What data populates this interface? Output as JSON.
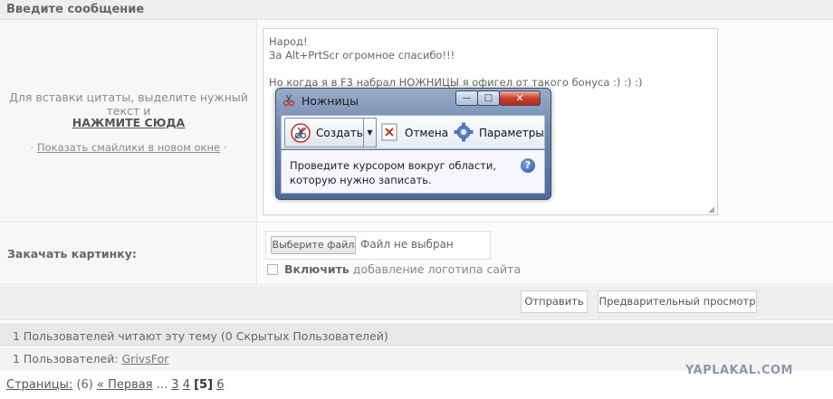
{
  "header": {
    "title": "Введите сообщение"
  },
  "message": {
    "quote_hint": "Для вставки цитаты, выделите нужный текст и",
    "quote_link": "НАЖМИТЕ СЮДА",
    "smiles_prefix": "·",
    "smiles_link": "Показать смайлики в новом окне",
    "smiles_suffix": "·",
    "text": "Народ!\nЗа Alt+PrtScr огромное спасибо!!!\n\nНо когда я в F3 набрал НОЖНИЦЫ я офигел от такого бонуса :) :) :)"
  },
  "snipping_tool": {
    "title": "Ножницы",
    "create_label": "Создать",
    "cancel_label": "Отмена",
    "options_label": "Параметры",
    "instruction": "Проведите курсором вокруг области, которую нужно записать.",
    "icons": {
      "app": "scissors-icon",
      "create": "scissors-icon",
      "cancel": "cancel-x-icon",
      "options": "gear-icon",
      "help": "help-icon"
    },
    "help_glyph": "?",
    "window_controls": {
      "minimize": "—",
      "maximize": "□",
      "close": "✕"
    }
  },
  "upload": {
    "label": "Закачать картинку:",
    "file_button": "Выберите файл",
    "file_status": "Файл не выбран",
    "logo_bold": "Включить",
    "logo_rest": "добавление логотипа сайта"
  },
  "actions": {
    "send": "Отправить",
    "preview": "Предварительный просмотр"
  },
  "readers": {
    "count_text": "1 Пользователей читают эту тему (0 Скрытых Пользователей)",
    "list_prefix": "1 Пользователей:",
    "user": "GrivsFor"
  },
  "pager": {
    "label": "Страницы:",
    "total": "(6)",
    "first": "« Первая",
    "ellipsis": "...",
    "pages": [
      "3",
      "4"
    ],
    "current": "[5]",
    "next": "6"
  },
  "watermark": "YAPLAKAL.COM"
}
